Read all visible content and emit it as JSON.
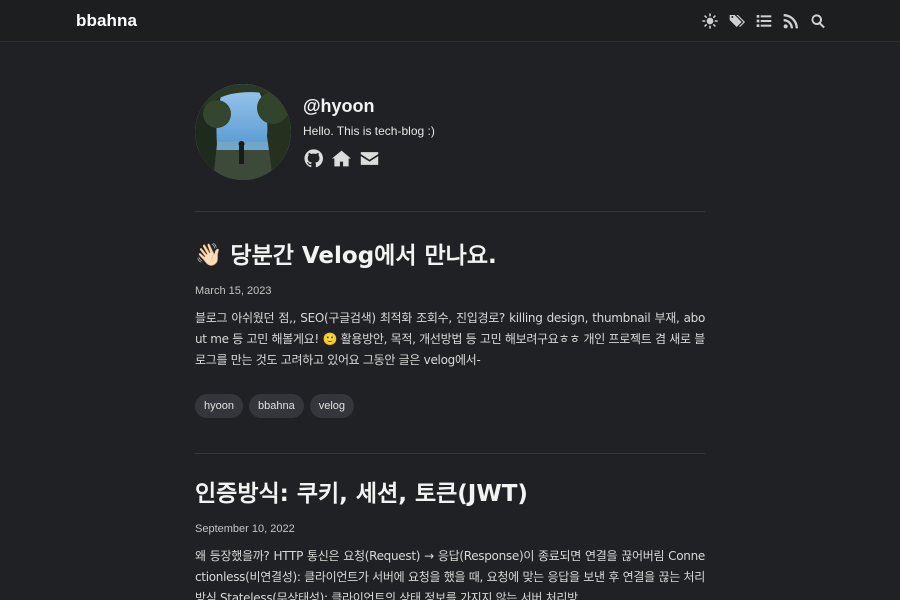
{
  "navbar": {
    "brand": "bbahna",
    "icons": [
      "sun-icon",
      "tags-icon",
      "list-icon",
      "rss-icon",
      "search-icon"
    ]
  },
  "profile": {
    "name": "@hyoon",
    "bio": "Hello. This is tech-blog :)",
    "links": [
      "github-icon",
      "home-icon",
      "envelope-icon"
    ]
  },
  "posts": [
    {
      "emoji": "👋🏻",
      "title": "당분간 Velog에서 만나요.",
      "date": "March 15, 2023",
      "excerpt": "블로그 아쉬웠던 점,, SEO(구글검색) 최적화 조회수, 진입경로? killing design, thumbnail 부재, about me 등 고민 해볼게요! 🙂 활용방안, 목적, 개선방법 등 고민 해보려구요ㅎㅎ 개인 프로젝트 겸 새로 블로그를 만는 것도 고려하고 있어요 그동안 글은 velog에서-",
      "tags": [
        "hyoon",
        "bbahna",
        "velog"
      ]
    },
    {
      "title": "인증방식: 쿠키, 세션, 토큰(JWT)",
      "date": "September 10, 2022",
      "excerpt": "왜 등장했을까? HTTP 통신은 요청(Request) → 응답(Response)이 종료되면 연결을 끊어버림 Connectionless(비연결성): 클라이언트가 서버에 요청을 했을 때, 요청에 맞는 응답을 보낸 후 연결을 끊는 처리방식 Stateless(무상태성): 클라이언트의 상태 정보를 가지지 않는 서버 처리방..."
    }
  ]
}
